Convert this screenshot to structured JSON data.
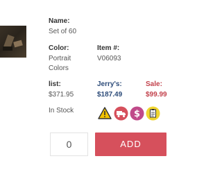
{
  "product": {
    "name_label": "Name:",
    "name_value": "Set of 60",
    "color_label": "Color:",
    "color_value_line1": "Portrait",
    "color_value_line2": "Colors",
    "item_label": "Item #:",
    "item_value": "V06093",
    "list_label": "list:",
    "list_price": "$371.95",
    "jerrys_label": "Jerry's:",
    "jerrys_price": "$187.49",
    "sale_label": "Sale:",
    "sale_price": "$99.99",
    "stock_status": "In Stock"
  },
  "badges": [
    {
      "icon": "warning-triangle-icon",
      "color": "#f2c200"
    },
    {
      "icon": "shipping-truck-icon",
      "color": "#d6505c"
    },
    {
      "icon": "dollar-sign-icon",
      "color": "#c04a8a"
    },
    {
      "icon": "clipboard-icon",
      "color": "#f0d530"
    }
  ],
  "cart": {
    "quantity": "0",
    "add_label": "ADD"
  },
  "colors": {
    "accent_red": "#d6505c",
    "price_blue": "#2b4a78",
    "sale_red": "#c2414b"
  }
}
